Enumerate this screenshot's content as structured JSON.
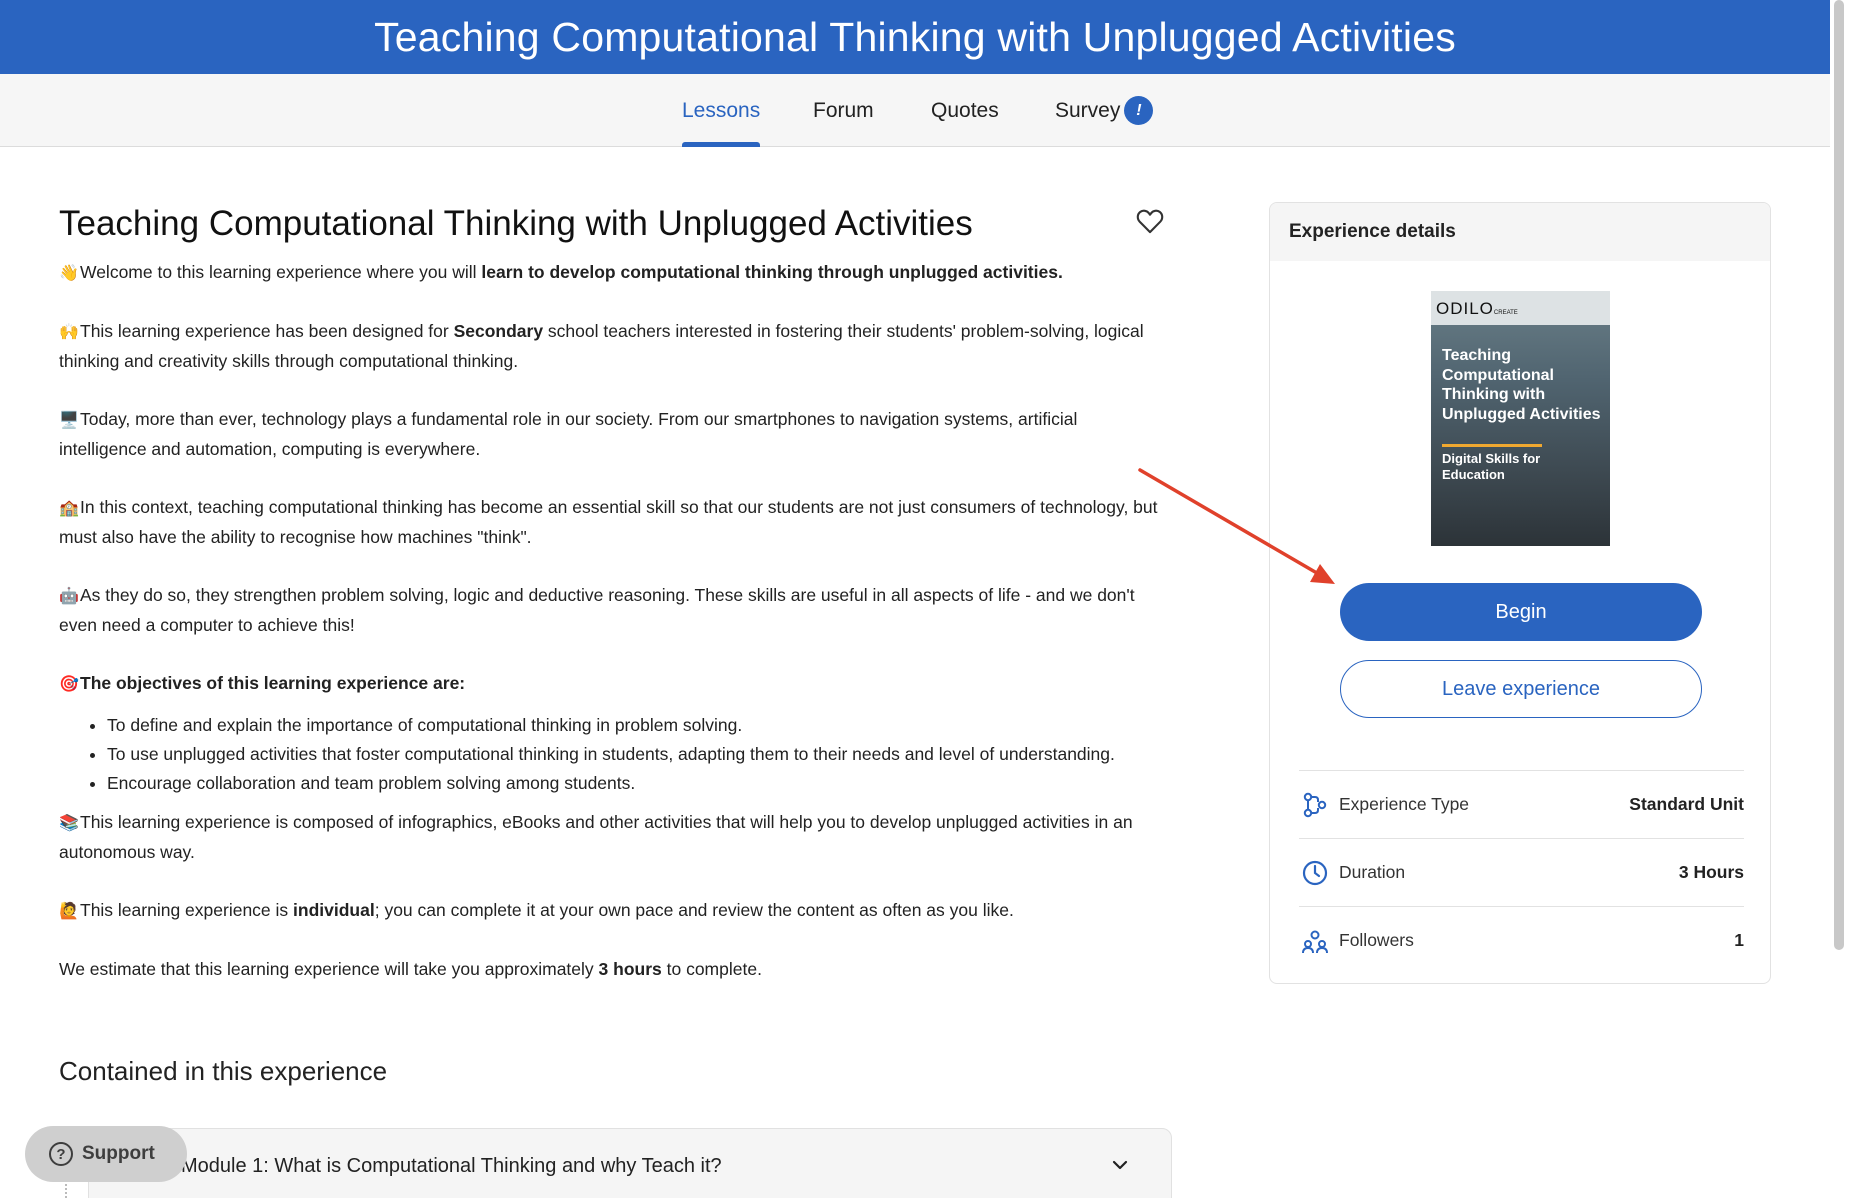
{
  "header": {
    "title": "Teaching Computational Thinking with Unplugged Activities"
  },
  "tabs": [
    {
      "label": "Lessons"
    },
    {
      "label": "Forum"
    },
    {
      "label": "Quotes"
    },
    {
      "label": "Survey"
    }
  ],
  "survey_badge": "!",
  "main": {
    "title": "Teaching Computational Thinking with Unplugged Activities",
    "p1_emoji": "👋",
    "p1_text": "Welcome to this learning experience where you will ",
    "p1_bold": "learn to develop computational thinking through unplugged activities.",
    "p2_emoji": "🙌",
    "p2_text_a": "This learning experience has been designed for ",
    "p2_bold": "Secondary",
    "p2_text_b": " school teachers interested in fostering their students' problem-solving, logical thinking and creativity skills through computational thinking.",
    "p3_emoji": "🖥️",
    "p3_text": "Today, more than ever, technology plays a fundamental role in our society. From our smartphones to navigation systems, artificial intelligence and automation, computing is everywhere.",
    "p4_emoji": "🏫",
    "p4_text": "In this context, teaching computational thinking has become an essential skill so that our students are not just consumers of technology, but must also have the ability to recognise how machines \"think\".",
    "p5_emoji": "🤖",
    "p5_text": "As they do so, they strengthen problem solving, logic and deductive reasoning. These skills are useful in all aspects of life - and we don't even need a computer to achieve this!",
    "obj_emoji": "🎯",
    "objectives_heading": "The objectives of this learning experience are:",
    "objectives": [
      "To define and explain the importance of computational thinking in problem solving.",
      "To use unplugged activities that foster computational thinking in students, adapting them to their needs and level of understanding.",
      "Encourage collaboration and team problem solving among students."
    ],
    "p6_emoji": "📚",
    "p6_text": "This learning experience is composed of infographics, eBooks and other activities that will help you to develop unplugged activities in an autonomous way.",
    "p7_emoji": "🙋",
    "p7_text_a": "This learning experience is ",
    "p7_bold": "individual",
    "p7_text_b": "; you can complete it at your own pace and review the content as often as you like.",
    "p8_text_a": "We estimate that this learning experience will take you approximately ",
    "p8_bold": "3 hours",
    "p8_text_b": " to complete.",
    "contained_title": "Contained in this experience",
    "module_1": "Module 1: What is Computational Thinking and why Teach it?"
  },
  "support": {
    "label": "Support",
    "icon": "?"
  },
  "panel": {
    "heading": "Experience details",
    "cover": {
      "logo": "ODILO",
      "logo_small": "CREATE",
      "title": "Teaching Computational Thinking with Unplugged Activities",
      "subtitle": "Digital Skills for Education"
    },
    "begin_label": "Begin",
    "leave_label": "Leave experience",
    "details": [
      {
        "label": "Experience Type",
        "value": "Standard Unit",
        "icon": "experience-type-icon"
      },
      {
        "label": "Duration",
        "value": "3 Hours",
        "icon": "clock-icon"
      },
      {
        "label": "Followers",
        "value": "1",
        "icon": "followers-icon"
      }
    ]
  },
  "colors": {
    "brand": "#2a64c0",
    "annotation_arrow": "#e0412b"
  }
}
